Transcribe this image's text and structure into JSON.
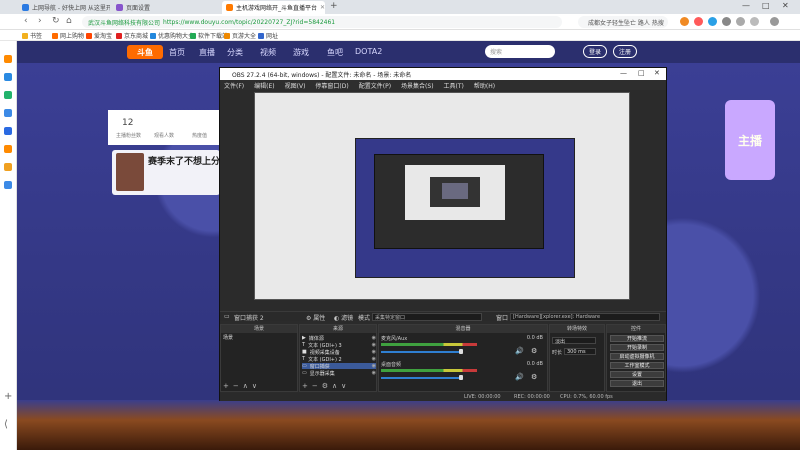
{
  "browser": {
    "tabs": [
      {
        "label": "上网导航 - 好快上网 从这里开始",
        "active": false,
        "color": "#2a7ae2"
      },
      {
        "label": "页面设置",
        "active": false,
        "color": "#8855cc"
      },
      {
        "label": "主机游戏网络开_斗鱼直播平台",
        "active": true,
        "color": "#ff7a00"
      }
    ],
    "new_tab": "+",
    "url_host": "武汉斗鱼网络科技有限公司",
    "url": "https://www.douyu.com/topic/20220727_ZJ?rid=5842461",
    "search_placeholder": "成都女子轻生坠亡 路人 热搜",
    "bookmarks": [
      "书签",
      "网上购物",
      "爱淘宝",
      "京东商城",
      "优惠购物大全",
      "软件下载站",
      "页游大全",
      "网址"
    ]
  },
  "site": {
    "logo": "斗鱼",
    "nav": [
      "首页",
      "直播",
      "分类",
      "视频",
      "游戏",
      "鱼吧",
      "DOTA2"
    ],
    "search_placeholder": "搜索",
    "login": "登录",
    "register": "注册",
    "stats": [
      {
        "num": "12",
        "label": "主播粉丝数"
      },
      {
        "num": "",
        "label": "观看人数"
      },
      {
        "num": "",
        "label": "热度值"
      }
    ],
    "post_title": "赛季末了不想上分",
    "right_banner": "主播"
  },
  "obs": {
    "title": "OBS 27.2.4 (64-bit, windows) - 配置文件: 未命名 - 场景: 未命名",
    "menus": [
      "文件(F)",
      "编辑(E)",
      "视图(V)",
      "停靠窗口(D)",
      "配置文件(P)",
      "场景集合(S)",
      "工具(T)",
      "帮助(H)"
    ],
    "toolbar": {
      "source_name": "窗口捕获 2",
      "properties": "属性",
      "filters": "滤镜",
      "mode_label": "模式",
      "mode_value": "采集特定窗口",
      "window_label": "窗口",
      "window_value": "[Hardware][xplorer.exe]: Hardware"
    },
    "docks": {
      "scenes": "场景",
      "sources": "来源",
      "mixer": "混音器",
      "transitions": "转场特效",
      "controls": "控件"
    },
    "scene_items": [
      "场景"
    ],
    "sources": [
      {
        "label": "媒体源",
        "icon": "▶",
        "selected": false
      },
      {
        "label": "文本 (GDI+) 3",
        "icon": "T",
        "selected": false
      },
      {
        "label": "视频采集设备",
        "icon": "■",
        "selected": false
      },
      {
        "label": "文本 (GDI+) 2",
        "icon": "T",
        "selected": false
      },
      {
        "label": "窗口捕获",
        "icon": "▭",
        "selected": true
      },
      {
        "label": "显示器采集",
        "icon": "▭",
        "selected": false
      }
    ],
    "mixer": [
      {
        "name": "麦克风/Aux",
        "db": "0.0 dB"
      },
      {
        "name": "桌面音频",
        "db": "0.0 dB"
      }
    ],
    "transitions": {
      "type": "淡出",
      "duration_label": "时长",
      "duration": "300 ms"
    },
    "controls": [
      "开始推流",
      "开始录制",
      "启动虚拟摄像机",
      "工作室模式",
      "设置",
      "退出"
    ],
    "status": {
      "live": "LIVE: 00:00:00",
      "rec": "REC: 00:00:00",
      "cpu": "CPU: 0.7%, 60.00 fps"
    }
  }
}
